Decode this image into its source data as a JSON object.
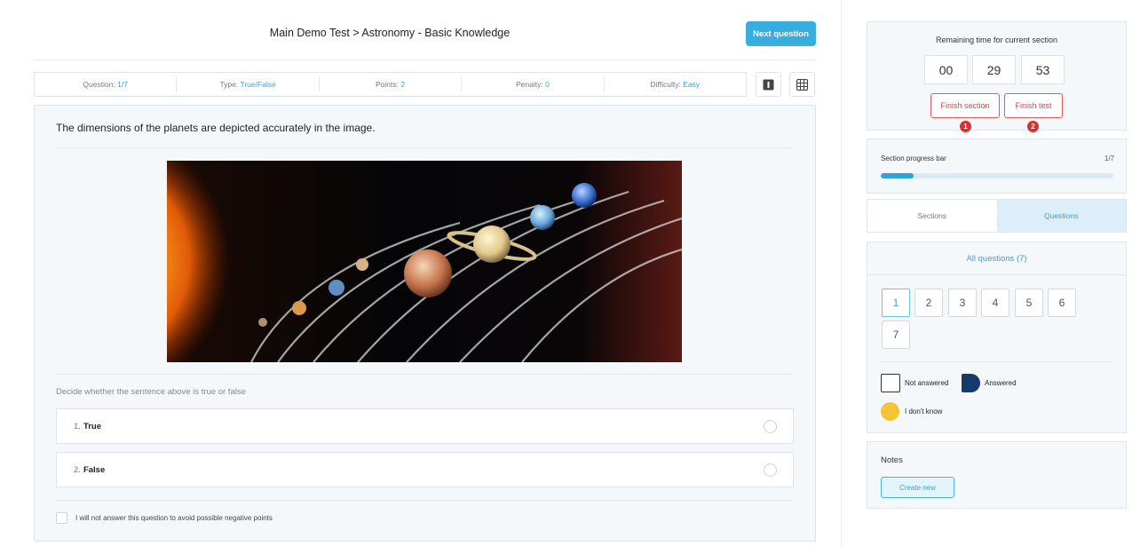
{
  "header": {
    "breadcrumb": "Main Demo Test > Astronomy - Basic Knowledge",
    "next_button": "Next question"
  },
  "info_bar": [
    {
      "label": "Question: ",
      "value": "1/7"
    },
    {
      "label": "Type: ",
      "value": "True/False"
    },
    {
      "label": "Points: ",
      "value": "2"
    },
    {
      "label": "Penalty: ",
      "value": "0"
    },
    {
      "label": "Difficulty: ",
      "value": "Easy"
    }
  ],
  "question": {
    "text": "The dimensions of the planets are depicted accurately in the image.",
    "instruction": "Decide whether the sentence above is true or false",
    "options": [
      {
        "num": "1.",
        "label": "True"
      },
      {
        "num": "2.",
        "label": "False"
      }
    ],
    "skip_label": "I will not answer this question to avoid possible negative points"
  },
  "timer": {
    "title": "Remaining time for current section",
    "hours": "00",
    "minutes": "29",
    "seconds": "53",
    "finish_section": "Finish section",
    "finish_test": "Finish test",
    "badge_1": "1",
    "badge_2": "2"
  },
  "progress": {
    "title": "Section progress bar",
    "count": "1/7",
    "fraction": 0.143
  },
  "tabs": {
    "sections": "Sections",
    "questions": "Questions"
  },
  "questions_panel": {
    "heading": "All questions (7)",
    "numbers": [
      "1",
      "2",
      "3",
      "4",
      "5",
      "6",
      "7"
    ],
    "legend": {
      "not_answered": "Not answered",
      "answered": "Answered",
      "dont_know": "I don't know"
    }
  },
  "notes": {
    "title": "Notes",
    "create_button": "Create new"
  },
  "colors": {
    "accent": "#38ade0",
    "danger": "#e2413d",
    "answered": "#163a6e",
    "dont_know": "#f5c433"
  }
}
